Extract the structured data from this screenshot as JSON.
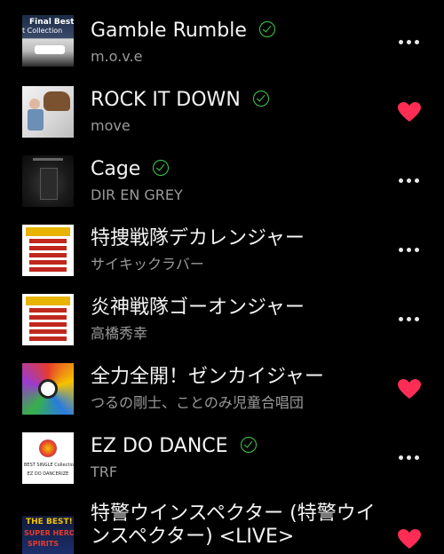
{
  "accent_color": "#3ccf4e",
  "heart_color": "#ff2d55",
  "tracks": [
    {
      "title": "Gamble Rumble",
      "artist": "m.o.v.e",
      "downloaded": true,
      "action_icon": "more-dots-icon",
      "art_text_1": "Final Best",
      "art_text_2": "t Collection"
    },
    {
      "title": "ROCK IT DOWN",
      "artist": "move",
      "downloaded": true,
      "action_icon": "heart-icon"
    },
    {
      "title": "Cage",
      "artist": "DIR EN GREY",
      "downloaded": true,
      "action_icon": "more-dots-icon"
    },
    {
      "title": "特捜戦隊デカレンジャー",
      "artist": "サイキックラバー",
      "downloaded": false,
      "action_icon": "more-dots-icon"
    },
    {
      "title": "炎神戦隊ゴーオンジャー",
      "artist": "高橋秀幸",
      "downloaded": false,
      "action_icon": "more-dots-icon"
    },
    {
      "title": "全力全開！ゼンカイジャー",
      "artist": "つるの剛士、ことのみ児童合唱団",
      "downloaded": false,
      "action_icon": "heart-icon"
    },
    {
      "title": "EZ DO DANCE",
      "artist": "TRF",
      "downloaded": true,
      "action_icon": "more-dots-icon",
      "art_text_1": "BEST SINGLE Collection",
      "art_text_2": "EZ DO DANCERIZE"
    },
    {
      "title": "特警ウインスペクター (特警ウインスペクター) <LIVE>",
      "artist": "",
      "downloaded": false,
      "action_icon": "heart-icon",
      "art_text_1": "THE BEST!!",
      "art_text_2": "SUPER HERO",
      "art_text_3": "SPIRITS"
    }
  ]
}
